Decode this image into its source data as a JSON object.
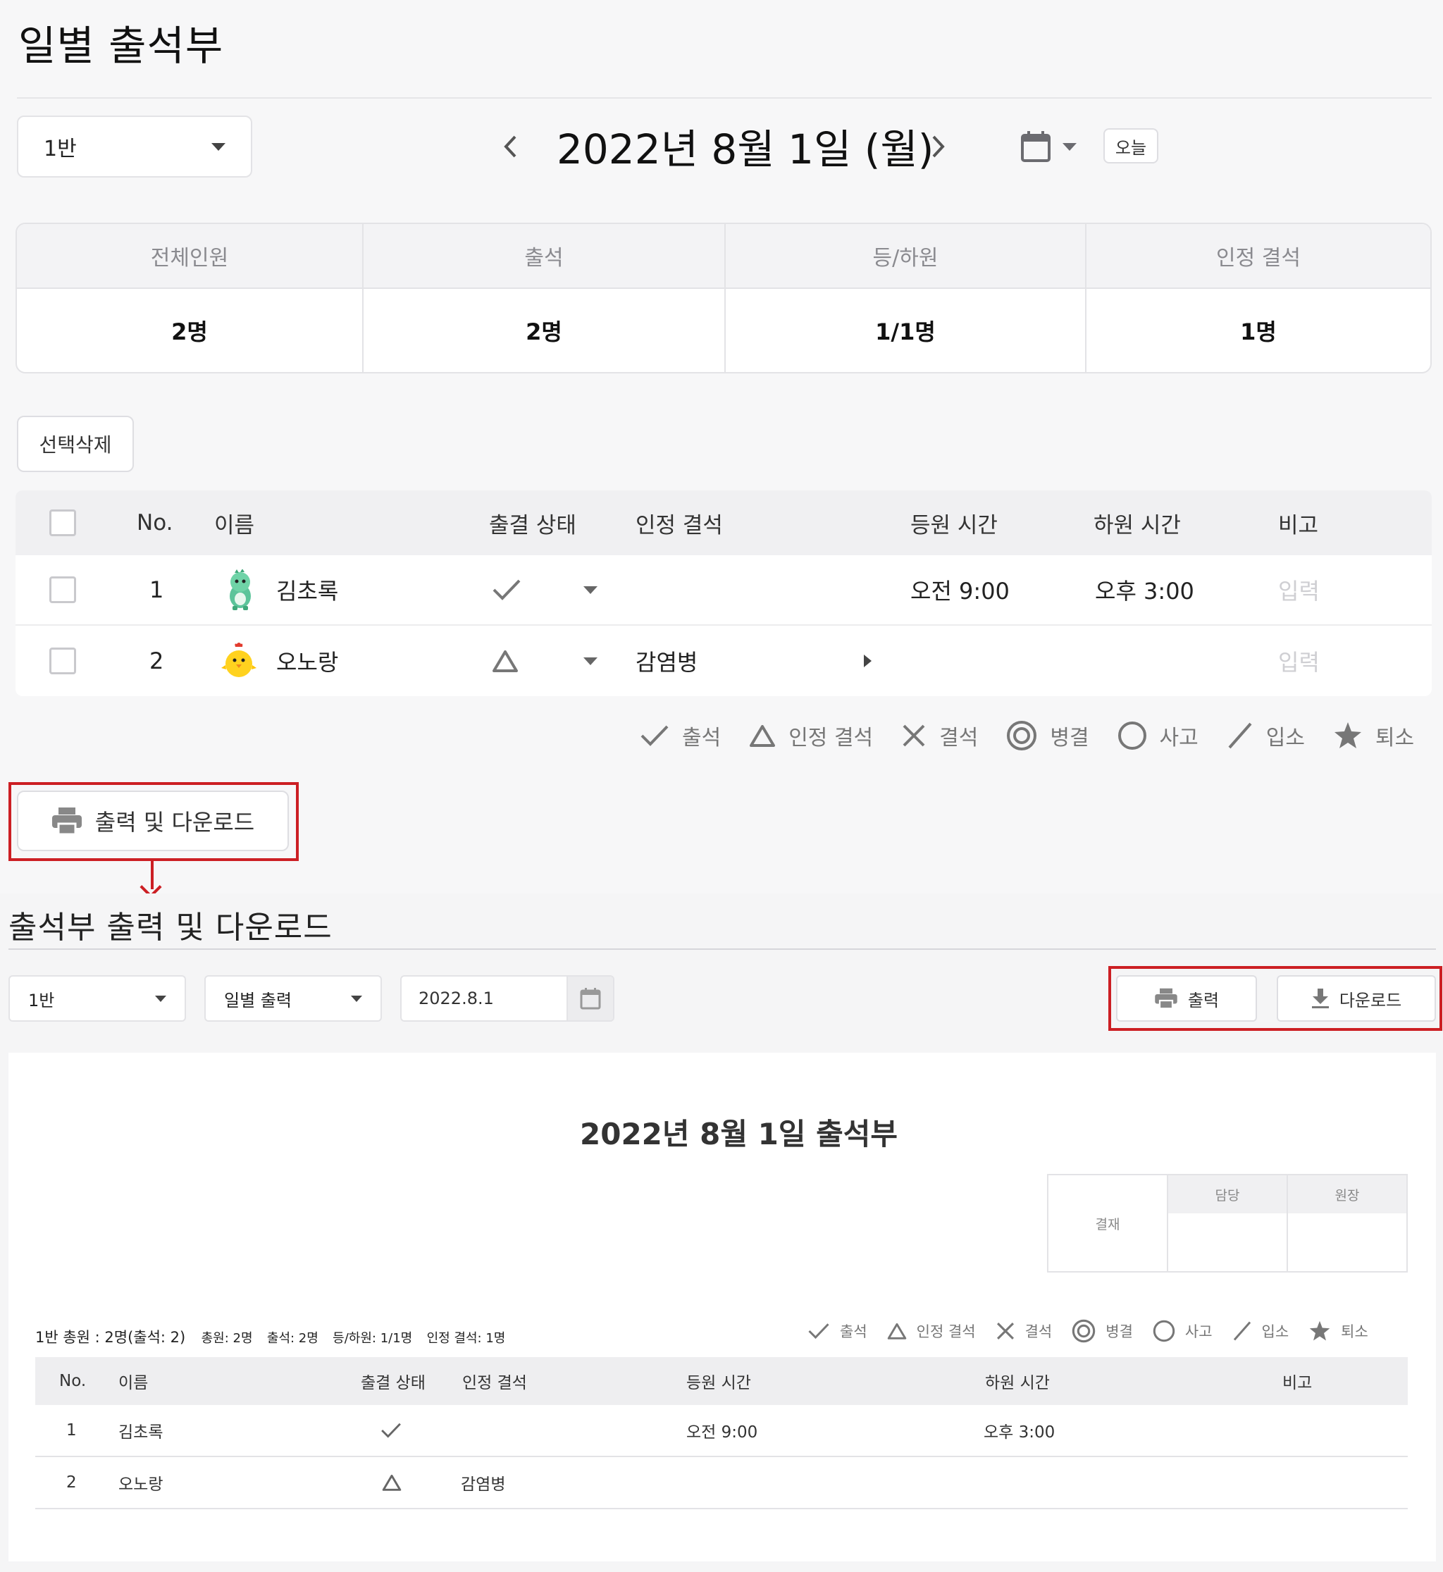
{
  "page": {
    "title": "일별 출석부"
  },
  "toolbar": {
    "class_value": "1반",
    "date_label": "2022년 8월 1일 (월)",
    "today_label": "오늘"
  },
  "summary": [
    {
      "label": "전체인원",
      "value": "2명"
    },
    {
      "label": "출석",
      "value": "2명"
    },
    {
      "label": "등/하원",
      "value": "1/1명"
    },
    {
      "label": "인정 결석",
      "value": "1명"
    }
  ],
  "actions": {
    "delete_label": "선택삭제",
    "print_download_label": "출력 및 다운로드"
  },
  "table": {
    "headers": {
      "no": "No.",
      "name": "이름",
      "status": "출결 상태",
      "excused": "인정 결석",
      "arrive": "등원 시간",
      "leave": "하원 시간",
      "note": "비고"
    },
    "rows": [
      {
        "no": "1",
        "name": "김초록",
        "status_icon": "check-icon",
        "excused": "",
        "arrive": "오전 9:00",
        "leave": "오후 3:00",
        "note_placeholder": "입력"
      },
      {
        "no": "2",
        "name": "오노랑",
        "status_icon": "triangle-icon",
        "excused": "감염병",
        "arrive": "",
        "leave": "",
        "note_placeholder": "입력"
      }
    ]
  },
  "legend": [
    {
      "icon": "check-icon",
      "label": "출석"
    },
    {
      "icon": "triangle-icon",
      "label": "인정 결석"
    },
    {
      "icon": "x-icon",
      "label": "결석"
    },
    {
      "icon": "double-circle-icon",
      "label": "병결"
    },
    {
      "icon": "circle-icon",
      "label": "사고"
    },
    {
      "icon": "slash-icon",
      "label": "입소"
    },
    {
      "icon": "star-icon",
      "label": "퇴소"
    }
  ],
  "print": {
    "title": "출석부 출력 및 다운로드",
    "class_value": "1반",
    "mode_value": "일별 출력",
    "date_value": "2022.8.1",
    "print_label": "출력",
    "download_label": "다운로드"
  },
  "sheet": {
    "title": "2022년 8월 1일 출석부",
    "approval": {
      "label": "결재",
      "col1": "담당",
      "col2": "원장"
    },
    "summary_main": "1반 총원 : 2명(출석: 2)",
    "summary_items": [
      "총원: 2명",
      "출석: 2명",
      "등/하원: 1/1명",
      "인정 결석: 1명"
    ],
    "headers": {
      "no": "No.",
      "name": "이름",
      "status": "출결 상태",
      "excused": "인정 결석",
      "arrive": "등원 시간",
      "leave": "하원 시간",
      "note": "비고"
    },
    "rows": [
      {
        "no": "1",
        "name": "김초록",
        "status_icon": "check-icon",
        "excused": "",
        "arrive": "오전 9:00",
        "leave": "오후 3:00"
      },
      {
        "no": "2",
        "name": "오노랑",
        "status_icon": "triangle-icon",
        "excused": "감염병",
        "arrive": "",
        "leave": ""
      }
    ]
  },
  "colors": {
    "highlight": "#cc1f24",
    "icon_gray": "#777777"
  }
}
